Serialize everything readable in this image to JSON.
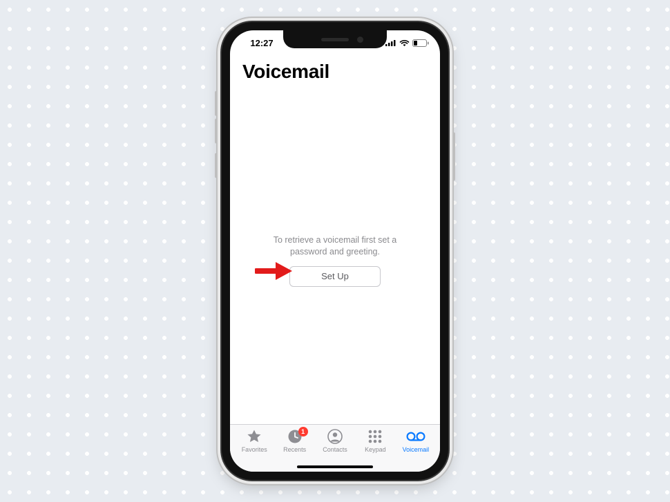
{
  "status": {
    "time": "12:27"
  },
  "page": {
    "title": "Voicemail",
    "instructions_line1": "To retrieve a voicemail first set a",
    "instructions_line2": "password and greeting.",
    "setup_button_label": "Set Up"
  },
  "tabs": {
    "favorites": {
      "label": "Favorites"
    },
    "recents": {
      "label": "Recents",
      "badge": "1"
    },
    "contacts": {
      "label": "Contacts"
    },
    "keypad": {
      "label": "Keypad"
    },
    "voicemail": {
      "label": "Voicemail"
    }
  },
  "colors": {
    "accent": "#0a7aff",
    "inactive": "#8e8e93",
    "arrow": "#e21b1b"
  }
}
